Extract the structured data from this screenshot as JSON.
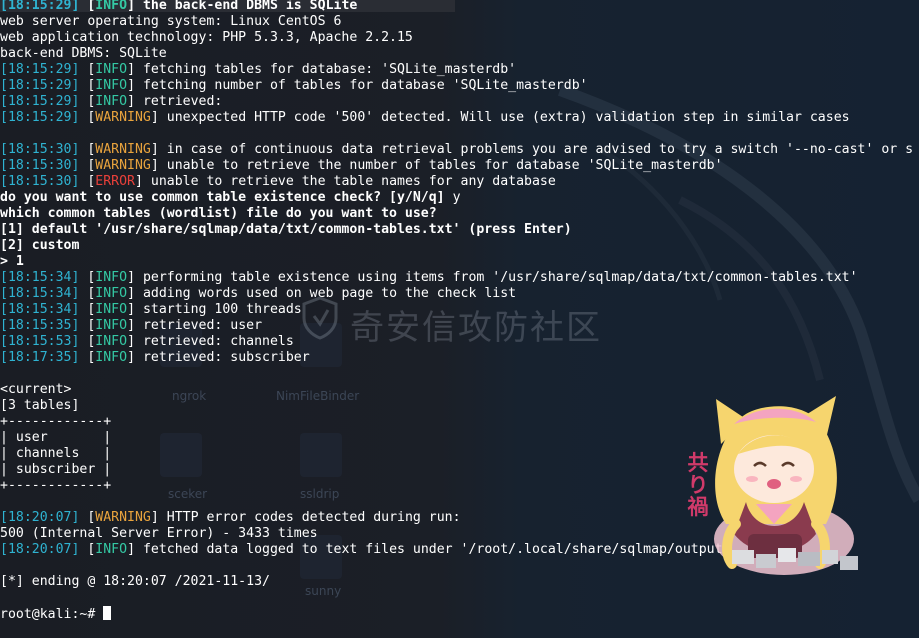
{
  "terminal": {
    "lines": [
      {
        "ts": "[18:15:29]",
        "level": "INFO",
        "msg": " the back-end DBMS is SQLite",
        "bold": true
      },
      {
        "text": "web server operating system: Linux CentOS 6"
      },
      {
        "text": "web application technology: PHP 5.3.3, Apache 2.2.15"
      },
      {
        "text": "back-end DBMS: SQLite"
      },
      {
        "ts": "[18:15:29]",
        "level": "INFO",
        "msg": " fetching tables for database: 'SQLite_masterdb'"
      },
      {
        "ts": "[18:15:29]",
        "level": "INFO",
        "msg": " fetching number of tables for database 'SQLite_masterdb'"
      },
      {
        "ts": "[18:15:29]",
        "level": "INFO",
        "msg": " retrieved:"
      },
      {
        "ts": "[18:15:29]",
        "level": "WARNING",
        "msg": " unexpected HTTP code '500' detected. Will use (extra) validation step in similar cases"
      },
      {
        "blank": true
      },
      {
        "ts": "[18:15:30]",
        "level": "WARNING",
        "msg": " in case of continuous data retrieval problems you are advised to try a switch '--no-cast' or s"
      },
      {
        "ts": "[18:15:30]",
        "level": "WARNING",
        "msg": " unable to retrieve the number of tables for database 'SQLite_masterdb'"
      },
      {
        "ts": "[18:15:30]",
        "level": "ERROR",
        "msg": " unable to retrieve the table names for any database"
      },
      {
        "text": "do you want to use common table existence check? [y/N/q] ",
        "bold": true,
        "input": "y"
      },
      {
        "text": "which common tables (wordlist) file do you want to use?",
        "bold": true
      },
      {
        "text": "[1] default '/usr/share/sqlmap/data/txt/common-tables.txt' (press Enter)",
        "bold": true
      },
      {
        "text": "[2] custom",
        "bold": true
      },
      {
        "text": "> 1",
        "bold": true
      },
      {
        "ts": "[18:15:34]",
        "level": "INFO",
        "msg": " performing table existence using items from '/usr/share/sqlmap/data/txt/common-tables.txt'"
      },
      {
        "ts": "[18:15:34]",
        "level": "INFO",
        "msg": " adding words used on web page to the check list"
      },
      {
        "ts": "[18:15:34]",
        "level": "INFO",
        "msg": " starting 100 threads"
      },
      {
        "ts": "[18:15:35]",
        "level": "INFO",
        "msg": " retrieved: user"
      },
      {
        "ts": "[18:15:53]",
        "level": "INFO",
        "msg": " retrieved: channels"
      },
      {
        "ts": "[18:17:35]",
        "level": "INFO",
        "msg": " retrieved: subscriber"
      },
      {
        "blank": true
      },
      {
        "text": "<current>"
      },
      {
        "text": "[3 tables]"
      },
      {
        "text": "+------------+"
      },
      {
        "text": "| user       |"
      },
      {
        "text": "| channels   |"
      },
      {
        "text": "| subscriber |"
      },
      {
        "text": "+------------+"
      },
      {
        "blank": true
      },
      {
        "ts": "[18:20:07]",
        "level": "WARNING",
        "msg": " HTTP error codes detected during run:"
      },
      {
        "text": "500 (Internal Server Error) - 3433 times"
      },
      {
        "ts": "[18:20:07]",
        "level": "INFO",
        "msg": " fetched data logged to text files under '/root/.local/share/sqlmap/output/"
      },
      {
        "blank": true
      },
      {
        "text": "[*] ending @ 18:20:07 /2021-11-13/"
      },
      {
        "blank": true
      },
      {
        "prompt": "root@kali:~# "
      }
    ]
  },
  "desktop": {
    "icon_labels": [
      {
        "label": "ngrok"
      },
      {
        "label": "NimFileBinder"
      },
      {
        "label": "sceker"
      },
      {
        "label": "ssldrip"
      },
      {
        "label": "sunny"
      }
    ]
  },
  "watermark": {
    "text": "奇安信攻防社区"
  },
  "sticker": {
    "text": "共\nり\n禍"
  },
  "colors": {
    "timestamp": "#2fb3d1",
    "info": "#34c9a4",
    "warning": "#e8a33d",
    "error": "#e8403a",
    "text": "#ffffff",
    "background": "#1b1f27"
  }
}
